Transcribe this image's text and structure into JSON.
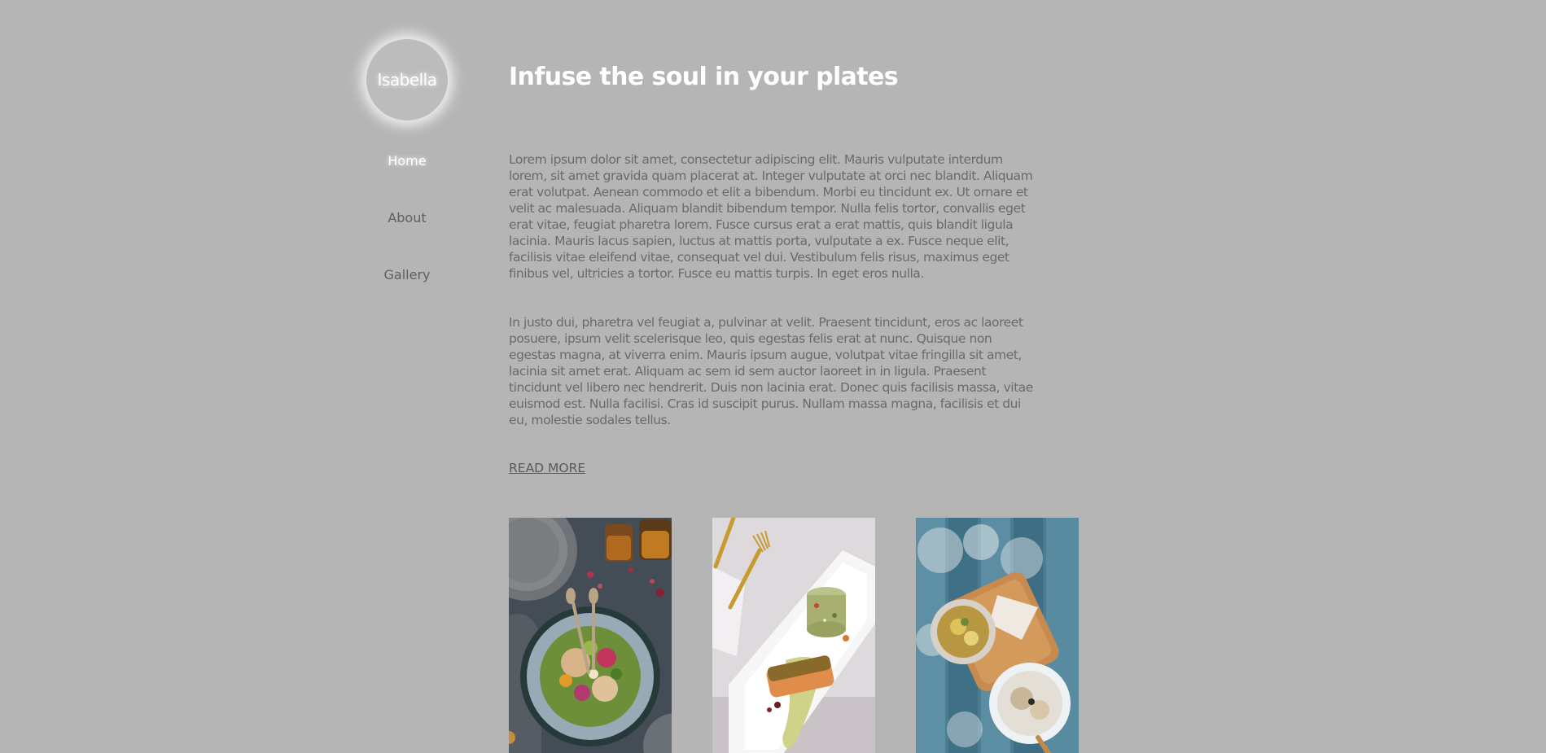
{
  "sidebar": {
    "logo_text": "Isabella",
    "nav": [
      {
        "label": "Home",
        "active": true
      },
      {
        "label": "About",
        "active": false
      },
      {
        "label": "Gallery",
        "active": false
      }
    ]
  },
  "main": {
    "title": "Infuse the soul in your plates",
    "paragraphs": [
      "Lorem ipsum dolor sit amet, consectetur adipiscing elit. Mauris vulputate interdum lorem, sit amet gravida quam placerat at. Integer vulputate at orci nec blandit. Aliquam erat volutpat. Aenean commodo et elit a bibendum. Morbi eu tincidunt ex. Ut ornare et velit ac malesuada. Aliquam blandit bibendum tempor. Nulla felis tortor, convallis eget erat vitae, feugiat pharetra lorem. Fusce cursus erat a erat mattis, quis blandit ligula lacinia. Mauris lacus sapien, luctus at mattis porta, vulputate a ex. Fusce neque elit, facilisis vitae eleifend vitae, consequat vel dui. Vestibulum felis risus, maximus eget finibus vel, ultricies a tortor. Fusce eu mattis turpis. In eget eros nulla.",
      "In justo dui, pharetra vel feugiat a, pulvinar at velit. Praesent tincidunt, eros ac laoreet posuere, ipsum velit scelerisque leo, quis egestas felis erat at nunc. Quisque non egestas magna, at viverra enim. Mauris ipsum augue, volutpat vitae fringilla sit amet, lacinia sit amet erat. Aliquam ac sem id sem auctor laoreet in in ligula. Praesent tincidunt vel libero nec hendrerit. Duis non lacinia erat. Donec quis facilisis massa, vitae euismod est. Nulla facilisi. Cras id suscipit purus. Nullam massa magna, facilisis et dui eu, molestie sodales tellus."
    ],
    "read_more": "READ MORE"
  },
  "gallery": [
    {
      "icon": "salad-bowl-photo"
    },
    {
      "icon": "salmon-plate-photo"
    },
    {
      "icon": "soup-bowls-photo"
    }
  ],
  "colors": {
    "background": "#b5b5b5",
    "body_text": "#6a6a6a",
    "heading": "#ffffff"
  }
}
